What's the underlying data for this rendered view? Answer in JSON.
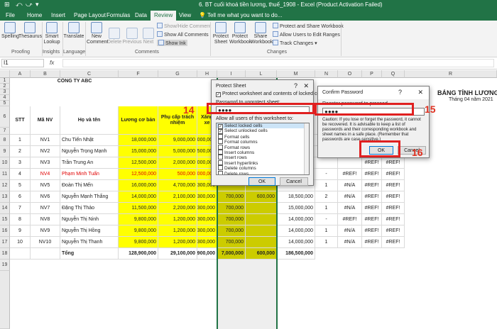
{
  "titlebar": {
    "title": "6. BT cuối khoá tiền lương, thuế_1908 - Excel (Product Activation Failed)",
    "controls": [
      "⊞",
      "⤺",
      "⤻",
      "▾"
    ]
  },
  "tabs": [
    "File",
    "Home",
    "Insert",
    "Page Layout",
    "Formulas",
    "Data",
    "Review",
    "View"
  ],
  "active_tab": "Review",
  "tellme": "Tell me what you want to do...",
  "ribbon": {
    "proofing": {
      "spelling": "Spelling",
      "thesaurus": "Thesaurus",
      "group": "Proofing"
    },
    "insights": {
      "smart_lookup": "Smart Lookup",
      "group": "Insights"
    },
    "language": {
      "translate": "Translate",
      "group": "Language"
    },
    "comments": {
      "new": "New Comment",
      "delete": "Delete",
      "previous": "Previous",
      "next": "Next",
      "show_hide": "Show/Hide Comment",
      "show_all": "Show All Comments",
      "show_ink": "Show Ink",
      "group": "Comments"
    },
    "changes": {
      "protect_sheet": "Protect Sheet",
      "protect_workbook": "Protect Workbook",
      "share_workbook": "Share Workbook",
      "protect_share": "Protect and Share Workbook",
      "allow_users": "Allow Users to Edit Ranges",
      "track_changes": "Track Changes",
      "group": "Changes"
    }
  },
  "formula_bar": {
    "name_box": "I1",
    "fx": "fx"
  },
  "columns": [
    "A",
    "B",
    "C",
    "F",
    "G",
    "H",
    "I",
    "L",
    "M",
    "N",
    "O",
    "P",
    "Q",
    "R"
  ],
  "rows": [
    "1",
    "2",
    "3",
    "4",
    "5",
    "6",
    "7",
    "8",
    "9",
    "10",
    "11",
    "12",
    "13",
    "14",
    "15",
    "16",
    "17",
    "18",
    "19"
  ],
  "sheet": {
    "company": "CÔNG TY ABC",
    "table_title": "BẢNG TÍNH LƯƠNG",
    "subtitle": "Tháng 04 năm 2021",
    "headers": {
      "stt": "STT",
      "manv": "Mã NV",
      "hoten": "Họ và tên",
      "luong": "Lương cơ bản",
      "phucap": "Phụ cấp trách nhiệm",
      "xangxe": "Xăng xe"
    },
    "employees": [
      {
        "stt": "1",
        "manv": "NV1",
        "name": "Chu Tiến Nhật",
        "luong": "18,000,000",
        "phucap": "9,000,000",
        "xang": "2,000,000",
        "i": "",
        "l": "",
        "m": "",
        "o": "",
        "p": "",
        "q": ""
      },
      {
        "stt": "2",
        "manv": "NV2",
        "name": "Nguyễn Trọng Mạnh",
        "luong": "15,000,000",
        "phucap": "5,000,000",
        "xang": "1,500,000",
        "i": "",
        "l": "",
        "m": "",
        "o": "",
        "p": "",
        "q": ""
      },
      {
        "stt": "3",
        "manv": "NV3",
        "name": "Trần Trung An",
        "luong": "12,500,000",
        "phucap": "2,000,000",
        "xang": "1,000,000",
        "i": "",
        "l": "",
        "m": "",
        "o": "",
        "p": "#REF!",
        "q": "#REF!"
      },
      {
        "stt": "4",
        "manv": "NV4",
        "name": "Phạm Minh Tuấn",
        "luong": "12,500,000",
        "phucap": "500,000",
        "xang": "1,000,000",
        "i": "",
        "l": "",
        "m": "",
        "n": "-",
        "o": "#REF!",
        "p": "#REF!",
        "q": "#REF!"
      },
      {
        "stt": "5",
        "manv": "NV5",
        "name": "Đoàn Thị Mến",
        "luong": "16,000,000",
        "phucap": "4,700,000",
        "xang": "300,000",
        "i": "",
        "l": "",
        "m": "",
        "n": "1",
        "o": "#N/A",
        "p": "#REF!",
        "q": "#REF!"
      },
      {
        "stt": "6",
        "manv": "NV6",
        "name": "Nguyễn Mạnh Thắng",
        "luong": "14,000,000",
        "phucap": "2,100,000",
        "xang": "300,000",
        "i": "700,000",
        "l": "600,000",
        "m": "18,500,000",
        "n": "2",
        "o": "#N/A",
        "p": "#REF!",
        "q": "#REF!"
      },
      {
        "stt": "7",
        "manv": "NV7",
        "name": "Đặng Thị Thảo",
        "luong": "11,500,000",
        "phucap": "2,200,000",
        "xang": "300,000",
        "i": "700,000",
        "l": "",
        "m": "15,000,000",
        "n": "1",
        "o": "#N/A",
        "p": "#REF!",
        "q": "#REF!"
      },
      {
        "stt": "8",
        "manv": "NV8",
        "name": "Nguyễn Thị Ninh",
        "luong": "9,800,000",
        "phucap": "1,200,000",
        "xang": "300,000",
        "i": "700,000",
        "l": "",
        "m": "14,000,000",
        "n": "-",
        "o": "#REF!",
        "p": "#REF!",
        "q": "#REF!"
      },
      {
        "stt": "9",
        "manv": "NV9",
        "name": "Nguyễn Thị Hồng",
        "luong": "9,800,000",
        "phucap": "1,200,000",
        "xang": "300,000",
        "i": "700,000",
        "l": "",
        "m": "14,000,000",
        "n": "1",
        "o": "#N/A",
        "p": "#REF!",
        "q": "#REF!"
      },
      {
        "stt": "10",
        "manv": "NV10",
        "name": "Nguyễn Thị Thanh",
        "luong": "9,800,000",
        "phucap": "1,200,000",
        "xang": "300,000",
        "i": "700,000",
        "l": "",
        "m": "14,000,000",
        "n": "1",
        "o": "#N/A",
        "p": "#REF!",
        "q": "#REF!"
      }
    ],
    "total": {
      "label": "Tổng",
      "luong": "128,900,000",
      "phucap": "29,100,000",
      "xang": "8,900,000",
      "i": "7,000,000",
      "l": "600,000",
      "m": "186,500,000"
    }
  },
  "protect_dialog": {
    "title": "Protect Sheet",
    "protect_label": "Protect worksheet and contents of locked cells",
    "pw_label": "Password to unprotect sheet:",
    "pw_value": "●●●●",
    "allow_label": "Allow all users of this worksheet to:",
    "options": [
      {
        "label": "Select locked cells",
        "checked": true
      },
      {
        "label": "Select unlocked cells",
        "checked": true
      },
      {
        "label": "Format cells",
        "checked": false
      },
      {
        "label": "Format columns",
        "checked": false
      },
      {
        "label": "Format rows",
        "checked": false
      },
      {
        "label": "Insert columns",
        "checked": false
      },
      {
        "label": "Insert rows",
        "checked": false
      },
      {
        "label": "Insert hyperlinks",
        "checked": false
      },
      {
        "label": "Delete columns",
        "checked": false
      },
      {
        "label": "Delete rows",
        "checked": false
      }
    ],
    "ok": "OK",
    "cancel": "Cancel",
    "help": "?"
  },
  "confirm_dialog": {
    "title": "Confirm Password",
    "help": "?",
    "label": "Reenter password to proceed.",
    "value": "●●●●",
    "caution": "Caution: If you lose or forget the password, it cannot be recovered. It is advisable to keep a list of passwords and their corresponding workbook and sheet names in a safe place. (Remember that passwords are case-sensitive.)",
    "ok": "OK",
    "cancel": "Cancel"
  },
  "annotations": {
    "a14": "14",
    "a15": "15",
    "a16": "16"
  },
  "accent": "#217346",
  "highlight": "#e02020"
}
